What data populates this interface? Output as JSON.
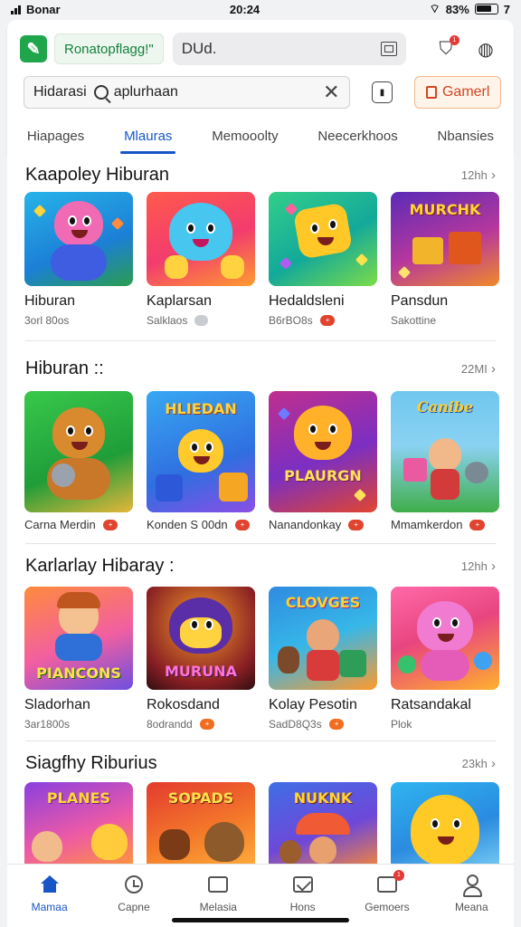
{
  "status_bar": {
    "time_left": "Bonar",
    "time_center": "20:24",
    "battery_text": "83%",
    "extra": "7"
  },
  "header": {
    "app_name": "Ronatopflagg!\"",
    "field_value": "DUd.",
    "notif_count": "1"
  },
  "search": {
    "prefix": "Hidarasi",
    "value": "aplurhaan",
    "clear_icon": "close-icon"
  },
  "game_button": {
    "label": "Gamerl"
  },
  "tabs": [
    {
      "label": "Hiapages"
    },
    {
      "label": "Mlauras"
    },
    {
      "label": "Memooolty"
    },
    {
      "label": "Neecerkhoos"
    },
    {
      "label": "Nbansies"
    }
  ],
  "sections": [
    {
      "title": "Kaapoley Hiburan",
      "more": "12hh",
      "items": [
        {
          "name": "Hiburan",
          "meta": "3orl 80os",
          "pill": ""
        },
        {
          "name": "Kaplarsan",
          "meta": "Salklaos",
          "pill": ""
        },
        {
          "name": "Hedaldsleni",
          "meta": "B6rBO8s",
          "pill": "+"
        },
        {
          "name": "Pansdun",
          "meta": "Sakottine",
          "pill": ""
        }
      ]
    },
    {
      "title": "Hiburan ::",
      "more": "22MI",
      "items": [
        {
          "name": "Carna Merdin",
          "meta": "",
          "pill": "+"
        },
        {
          "name": "Konden S 00dn",
          "meta": "",
          "pill": "+"
        },
        {
          "name": "Nanandonkay",
          "meta": "",
          "pill": "+"
        },
        {
          "name": "Mmamkerdon",
          "meta": "",
          "pill": "+"
        }
      ]
    },
    {
      "title": "Karlarlay Hibaray :",
      "more": "12hh",
      "items": [
        {
          "name": "Sladorhan",
          "meta": "3ar1800s",
          "pill": ""
        },
        {
          "name": "Rokosdand",
          "meta": "8odrandd",
          "pill": "+"
        },
        {
          "name": "Kolay Pesotin",
          "meta": "SadD8Q3s",
          "pill": "+"
        },
        {
          "name": "Ratsandakal",
          "meta": "Plok",
          "pill": ""
        }
      ]
    },
    {
      "title": "Siagfhy Riburius",
      "more": "23kh",
      "items": [
        {
          "name": "",
          "meta": "",
          "pill": ""
        },
        {
          "name": "",
          "meta": "",
          "pill": ""
        },
        {
          "name": "",
          "meta": "",
          "pill": ""
        },
        {
          "name": "",
          "meta": "",
          "pill": ""
        }
      ]
    }
  ],
  "art_text": {
    "s1_3": "MURCHK",
    "s2_1": "",
    "s2_2": "HLIEDAN",
    "s2_3": "PLAURGN",
    "s2_4": "Canibe",
    "s3_1": "PIANCONS",
    "s3_2": "MURUNA",
    "s3_3": "CLOVGES",
    "s4_1": "PLANES",
    "s4_2": "SOPADS",
    "s4_3": "NUKNK"
  },
  "bottom_nav": [
    {
      "label": "Mamaa",
      "icon": "home-icon"
    },
    {
      "label": "Capne",
      "icon": "clock-icon"
    },
    {
      "label": "Melasia",
      "icon": "card-icon"
    },
    {
      "label": "Hons",
      "icon": "mail-icon"
    },
    {
      "label": "Gemoers",
      "icon": "inbox-icon",
      "badge": "1"
    },
    {
      "label": "Meana",
      "icon": "user-icon"
    }
  ],
  "colors": {
    "accent": "#1856c8",
    "game_button": "#d2451f",
    "logo": "#1fa64b"
  }
}
